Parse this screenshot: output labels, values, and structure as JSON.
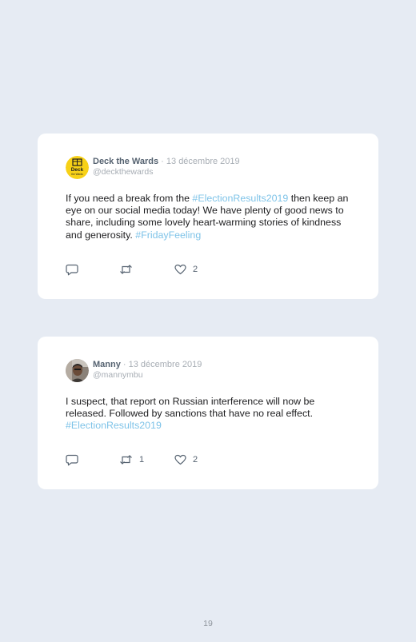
{
  "tweets": [
    {
      "name": "Deck the Wards",
      "date": " · 13 décembre 2019",
      "handle": "@deckthewards",
      "avatar_logo_text": "Deck the Wards",
      "text_part1": "If you need a break from the ",
      "hashtag1": "#ElectionResults2019",
      "text_part2": " then keep an eye on our social media today! We have plenty of good news to share, including some lovely heart-warming stories of kindness and generosity. ",
      "hashtag2": "#FridayFeeling",
      "reply_count": "",
      "retweet_count": "",
      "like_count": "2"
    },
    {
      "name": "Manny",
      "date": " · 13 décembre 2019",
      "handle": "@mannymbu",
      "text_part1": "I suspect, that report on Russian interference will now be released. Followed by sanctions that have no real effect.",
      "hashtag1": "#ElectionResults2019",
      "reply_count": "",
      "retweet_count": "1",
      "like_count": "2"
    }
  ],
  "page_number": "19",
  "colors": {
    "background": "#e6ebf3",
    "card": "#ffffff",
    "hashtag": "#7ec3e8",
    "name": "#556270",
    "meta": "#a7adb4",
    "avatar_yellow": "#f7d117"
  },
  "icons": {
    "reply": "reply-icon",
    "retweet": "retweet-icon",
    "like": "heart-icon"
  }
}
